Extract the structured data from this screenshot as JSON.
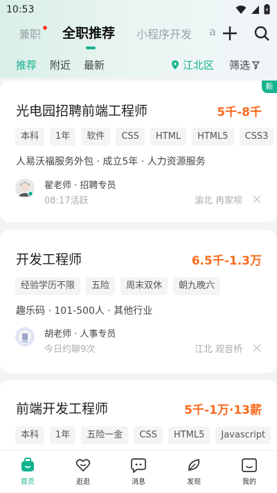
{
  "status": {
    "time": "10:53"
  },
  "top_tabs": [
    "兼职",
    "全职推荐",
    "小程序开发",
    "a"
  ],
  "filters": {
    "items": [
      "推荐",
      "附近",
      "最新"
    ],
    "location": "江北区",
    "screen": "筛选"
  },
  "colors": {
    "accent": "#14b38d",
    "salary": "#fa6a1e"
  },
  "jobs": [
    {
      "title": "光电园招聘前端工程师",
      "salary": "5千-8千",
      "badge": "新",
      "tags": [
        "本科",
        "1年",
        "软件",
        "CSS",
        "HTML",
        "HTML5",
        "CSS3"
      ],
      "company": "人易沃福服务外包 · 成立5年 · 人力资源服务",
      "recruiter": "翟老师 · 招聘专员",
      "activity": "08:17活跃",
      "area": "渝北 冉家坝"
    },
    {
      "title": "开发工程师",
      "salary": "6.5千-1.3万",
      "tags": [
        "经验学历不限",
        "五险",
        "周末双休",
        "朝九晚六"
      ],
      "company": "趣乐码 · 101-500人 · 其他行业",
      "recruiter": "胡老师 · 人事专员",
      "activity": "今日约聊9次",
      "area": "江北 观音桥"
    },
    {
      "title": "前端开发工程师",
      "salary": "5千-1万·13薪",
      "tags": [
        "本科",
        "1年",
        "五险一金",
        "CSS",
        "HTML5",
        "Javascript"
      ]
    }
  ],
  "bottom_nav": [
    "首页",
    "逛逛",
    "消息",
    "发现",
    "我的"
  ]
}
